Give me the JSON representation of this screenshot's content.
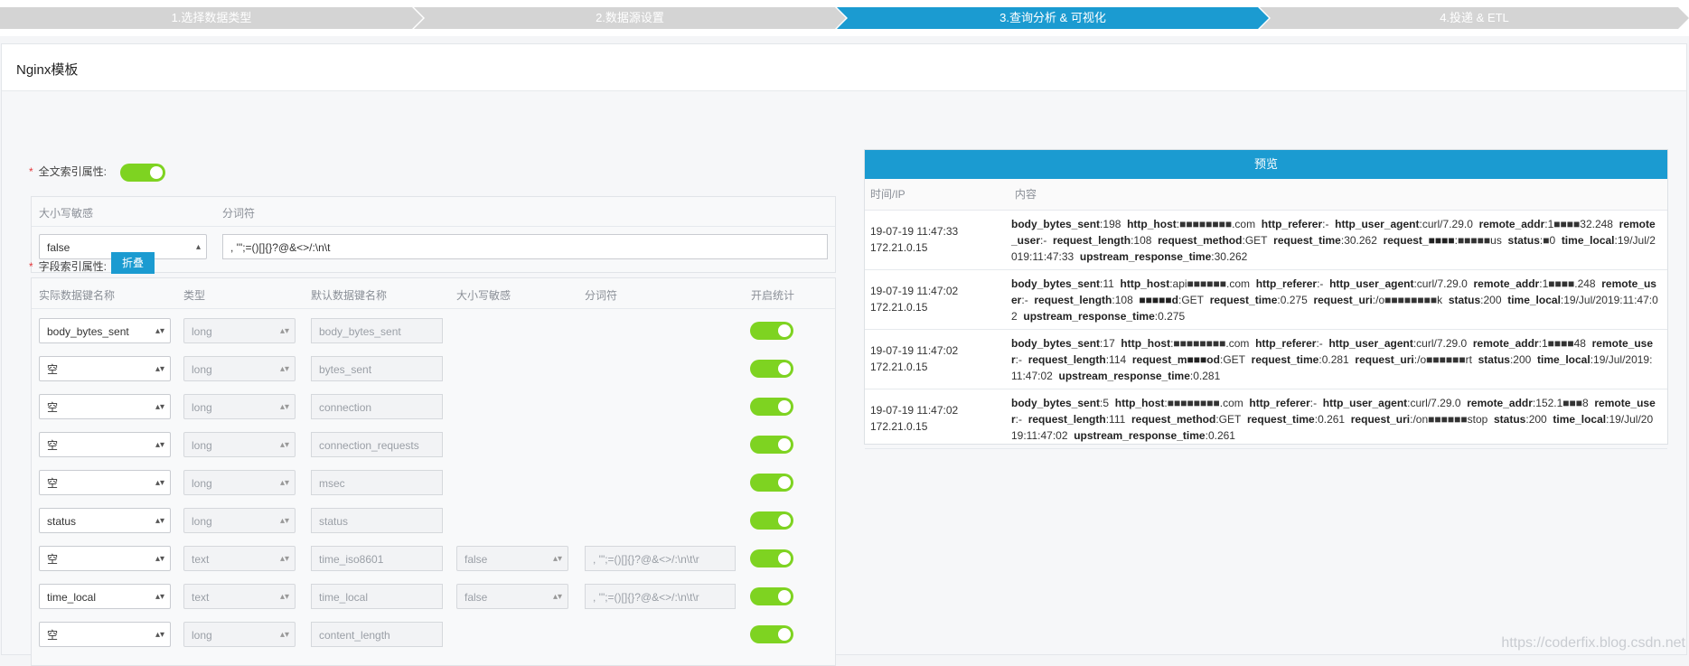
{
  "steps": [
    {
      "label": "1.选择数据类型",
      "active": false
    },
    {
      "label": "2.数据源设置",
      "active": false
    },
    {
      "label": "3.查询分析 & 可视化",
      "active": true
    },
    {
      "label": "4.投递 & ETL",
      "active": false
    }
  ],
  "card": {
    "title": "Nginx模板"
  },
  "fulltext": {
    "label": "全文索引属性:",
    "headers": {
      "case": "大小写敏感",
      "delim": "分词符"
    },
    "case_value": "false",
    "delim_value": ", '\";=()[]{}?@&<>/:\\n\\t"
  },
  "field_index": {
    "label": "字段索引属性:",
    "fold_label": "折叠",
    "headers": [
      "实际数据键名称",
      "类型",
      "默认数据键名称",
      "大小写敏感",
      "分词符",
      "开启统计"
    ],
    "rows": [
      {
        "actual": "body_bytes_sent",
        "type": "long",
        "default": "body_bytes_sent",
        "case": "",
        "delim": ""
      },
      {
        "actual": "空",
        "type": "long",
        "default": "bytes_sent",
        "case": "",
        "delim": ""
      },
      {
        "actual": "空",
        "type": "long",
        "default": "connection",
        "case": "",
        "delim": ""
      },
      {
        "actual": "空",
        "type": "long",
        "default": "connection_requests",
        "case": "",
        "delim": ""
      },
      {
        "actual": "空",
        "type": "long",
        "default": "msec",
        "case": "",
        "delim": ""
      },
      {
        "actual": "status",
        "type": "long",
        "default": "status",
        "case": "",
        "delim": ""
      },
      {
        "actual": "空",
        "type": "text",
        "default": "time_iso8601",
        "case": "false",
        "delim": ", '\";=()[]{}?@&<>/:\\n\\t\\r"
      },
      {
        "actual": "time_local",
        "type": "text",
        "default": "time_local",
        "case": "false",
        "delim": ", '\";=()[]{}?@&<>/:\\n\\t\\r"
      },
      {
        "actual": "空",
        "type": "long",
        "default": "content_length",
        "case": "",
        "delim": ""
      }
    ]
  },
  "preview": {
    "title": "预览",
    "col_time": "时间/IP",
    "col_content": "内容",
    "rows": [
      {
        "time": "19-07-19 11:47:33",
        "ip": "172.21.0.15",
        "pairs": [
          {
            "k": "body_bytes_sent",
            "v": "198"
          },
          {
            "k": "http_host",
            "v": "■■■■■■■■.com"
          },
          {
            "k": "http_referer",
            "v": "-"
          },
          {
            "k": "http_user_agent",
            "v": "curl/7.29.0"
          },
          {
            "k": "remote_addr",
            "v": "1■■■■32.248"
          },
          {
            "k": "remote_user",
            "v": "-"
          },
          {
            "k": "request_length",
            "v": "108"
          },
          {
            "k": "request_method",
            "v": "GET"
          },
          {
            "k": "request_time",
            "v": "30.262"
          },
          {
            "k": "request_■■■■",
            "v": "■■■■■us"
          },
          {
            "k": "status",
            "v": "■0"
          },
          {
            "k": "time_local",
            "v": "19/Jul/2019:11:47:33"
          },
          {
            "k": "upstream_response_time",
            "v": "30.262"
          }
        ]
      },
      {
        "time": "19-07-19 11:47:02",
        "ip": "172.21.0.15",
        "pairs": [
          {
            "k": "body_bytes_sent",
            "v": "11"
          },
          {
            "k": "http_host",
            "v": "api■■■■■■.com"
          },
          {
            "k": "http_referer",
            "v": "-"
          },
          {
            "k": "http_user_agent",
            "v": "curl/7.29.0"
          },
          {
            "k": "remote_addr",
            "v": "1■■■■.248"
          },
          {
            "k": "remote_user",
            "v": "-"
          },
          {
            "k": "request_length",
            "v": "108"
          },
          {
            "k": "■■■■■d",
            "v": "GET"
          },
          {
            "k": "request_time",
            "v": "0.275"
          },
          {
            "k": "request_uri",
            "v": "/o■■■■■■■■k"
          },
          {
            "k": "status",
            "v": "200"
          },
          {
            "k": "time_local",
            "v": "19/Jul/2019:11:47:02"
          },
          {
            "k": "upstream_response_time",
            "v": "0.275"
          }
        ]
      },
      {
        "time": "19-07-19 11:47:02",
        "ip": "172.21.0.15",
        "pairs": [
          {
            "k": "body_bytes_sent",
            "v": "17"
          },
          {
            "k": "http_host",
            "v": "■■■■■■■■.com"
          },
          {
            "k": "http_referer",
            "v": "-"
          },
          {
            "k": "http_user_agent",
            "v": "curl/7.29.0"
          },
          {
            "k": "remote_addr",
            "v": "1■■■■48"
          },
          {
            "k": "remote_user",
            "v": "-"
          },
          {
            "k": "request_length",
            "v": "114"
          },
          {
            "k": "request_m■■■od",
            "v": "GET"
          },
          {
            "k": "request_time",
            "v": "0.281"
          },
          {
            "k": "request_uri",
            "v": "/o■■■■■■rt"
          },
          {
            "k": "status",
            "v": "200"
          },
          {
            "k": "time_local",
            "v": "19/Jul/2019:11:47:02"
          },
          {
            "k": "upstream_response_time",
            "v": "0.281"
          }
        ]
      },
      {
        "time": "19-07-19 11:47:02",
        "ip": "172.21.0.15",
        "pairs": [
          {
            "k": "body_bytes_sent",
            "v": "5"
          },
          {
            "k": "http_host",
            "v": "■■■■■■■■.com"
          },
          {
            "k": "http_referer",
            "v": "-"
          },
          {
            "k": "http_user_agent",
            "v": "curl/7.29.0"
          },
          {
            "k": "remote_addr",
            "v": "152.1■■■8"
          },
          {
            "k": "remote_user",
            "v": "-"
          },
          {
            "k": "request_length",
            "v": "111"
          },
          {
            "k": "request_method",
            "v": "GET"
          },
          {
            "k": "request_time",
            "v": "0.261"
          },
          {
            "k": "request_uri",
            "v": "/on■■■■■■stop"
          },
          {
            "k": "status",
            "v": "200"
          },
          {
            "k": "time_local",
            "v": "19/Jul/2019:11:47:02"
          },
          {
            "k": "upstream_response_time",
            "v": "0.261"
          }
        ]
      }
    ]
  },
  "watermark": "https://coderfix.blog.csdn.net",
  "colors": {
    "accent": "#1b9bd1",
    "toggle_on": "#7ed321",
    "step_inactive": "#d4d4d4"
  }
}
